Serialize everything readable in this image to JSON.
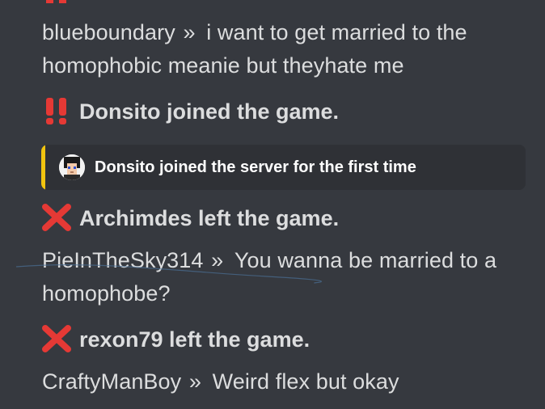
{
  "messages": [
    {
      "author": "blueboundary",
      "separator": "»",
      "text": "i want to get married to the homophobic meanie but theyhate me"
    },
    {
      "author": "PieInTheSky314",
      "separator": "»",
      "text": "You wanna be married to a homophobe?"
    },
    {
      "author": "CraftyManBoy",
      "separator": "»",
      "text": "Weird flex but okay"
    }
  ],
  "events": {
    "donsito_join": "Donsito joined the game.",
    "archimdes_leave": "Archimdes left the game.",
    "rexon_leave": "rexon79 left the game."
  },
  "embed": {
    "text": "Donsito joined the server for the first time",
    "accent_color": "#f1c40f"
  },
  "icons": {
    "join": "double-exclamation-icon",
    "leave": "cross-mark-icon"
  },
  "colors": {
    "background": "#36393f",
    "text": "#dcddde",
    "join_icon": "#e53935",
    "leave_icon": "#e53935"
  }
}
